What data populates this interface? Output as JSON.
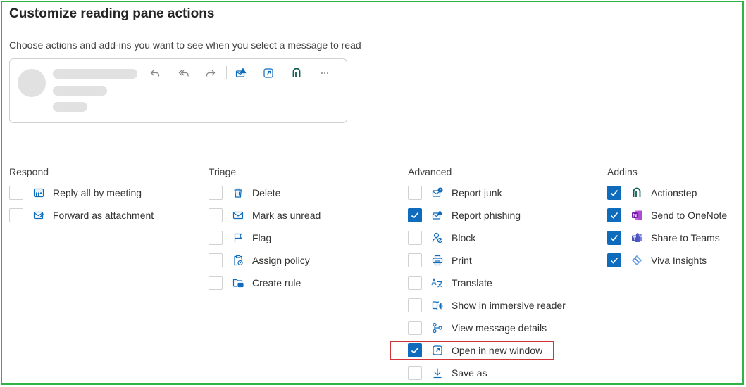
{
  "dialog": {
    "title": "Customize reading pane actions",
    "subtitle": "Choose actions and add-ins you want to see when you select a message to read"
  },
  "preview_toolbar_icons": [
    "reply-icon",
    "reply-all-icon",
    "forward-icon",
    "report-phishing-icon",
    "open-new-window-icon",
    "actionstep-icon",
    "more-icon"
  ],
  "columns": {
    "respond": {
      "heading": "Respond",
      "items": [
        {
          "label": "Reply all by meeting",
          "checked": false,
          "icon": "calendar-reply-icon"
        },
        {
          "label": "Forward as attachment",
          "checked": false,
          "icon": "mail-attachment-icon"
        }
      ]
    },
    "triage": {
      "heading": "Triage",
      "items": [
        {
          "label": "Delete",
          "checked": false,
          "icon": "trash-icon"
        },
        {
          "label": "Mark as unread",
          "checked": false,
          "icon": "envelope-icon"
        },
        {
          "label": "Flag",
          "checked": false,
          "icon": "flag-icon"
        },
        {
          "label": "Assign policy",
          "checked": false,
          "icon": "clipboard-clock-icon"
        },
        {
          "label": "Create rule",
          "checked": false,
          "icon": "folder-mail-icon"
        }
      ]
    },
    "advanced": {
      "heading": "Advanced",
      "items": [
        {
          "label": "Report junk",
          "checked": false,
          "icon": "mail-warning-icon"
        },
        {
          "label": "Report phishing",
          "checked": true,
          "icon": "mail-alert-icon"
        },
        {
          "label": "Block",
          "checked": false,
          "icon": "person-block-icon"
        },
        {
          "label": "Print",
          "checked": false,
          "icon": "printer-icon"
        },
        {
          "label": "Translate",
          "checked": false,
          "icon": "translate-icon"
        },
        {
          "label": "Show in immersive reader",
          "checked": false,
          "icon": "immersive-reader-icon"
        },
        {
          "label": "View message details",
          "checked": false,
          "icon": "branch-details-icon"
        },
        {
          "label": "Open in new window",
          "checked": true,
          "icon": "open-new-window-icon"
        },
        {
          "label": "Save as",
          "checked": false,
          "icon": "download-arrow-icon"
        }
      ]
    },
    "addins": {
      "heading": "Addins",
      "items": [
        {
          "label": "Actionstep",
          "checked": true,
          "icon": "actionstep-icon"
        },
        {
          "label": "Send to OneNote",
          "checked": true,
          "icon": "onenote-icon"
        },
        {
          "label": "Share to Teams",
          "checked": true,
          "icon": "teams-icon"
        },
        {
          "label": "Viva Insights",
          "checked": true,
          "icon": "viva-insights-icon"
        }
      ]
    }
  },
  "colors": {
    "accent": "#0f6cbd",
    "frame_border": "#2fb344",
    "highlight_border": "#d13438"
  }
}
